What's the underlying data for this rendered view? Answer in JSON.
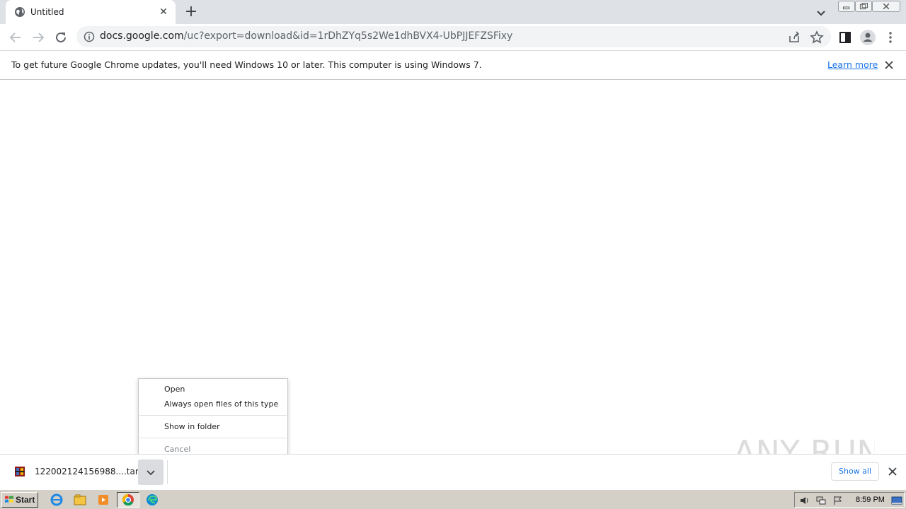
{
  "tab": {
    "title": "Untitled",
    "close_glyph": "✕",
    "new_tab_glyph": "+"
  },
  "omnibox": {
    "url_host": "docs.google.com",
    "url_path": "/uc?export=download&id=1rDhZYq5s2We1dhBVX4-UbPJJEFZSFixy"
  },
  "infobar": {
    "message": "To get future Google Chrome updates, you'll need Windows 10 or later. This computer is using Windows 7.",
    "learn_more": "Learn more"
  },
  "context_menu": {
    "items": [
      "Open",
      "Always open files of this type",
      "Show in folder",
      "Cancel"
    ]
  },
  "download": {
    "file_name": "122002124156988....tar",
    "show_all": "Show all"
  },
  "watermark": {
    "text": "ANY RUN"
  },
  "taskbar": {
    "start_label": "Start",
    "clock": "8:59 PM"
  },
  "colors": {
    "accent": "#1a73e8",
    "tabstrip": "#dee1e6",
    "taskbar": "#d4d0c8"
  }
}
